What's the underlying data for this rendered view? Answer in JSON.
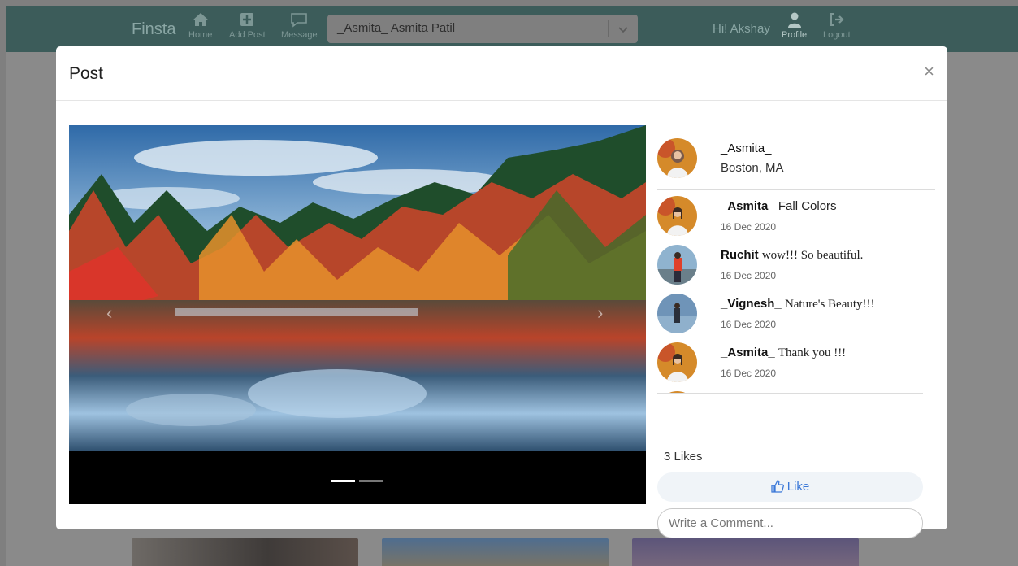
{
  "navbar": {
    "brand": "Finsta",
    "items": [
      {
        "label": "Home",
        "icon": "home-icon"
      },
      {
        "label": "Add Post",
        "icon": "add-post-icon"
      },
      {
        "label": "Message",
        "icon": "message-icon"
      },
      {
        "label": "Profile",
        "icon": "user-icon"
      },
      {
        "label": "Logout",
        "icon": "logout-icon"
      }
    ],
    "search_value": "_Asmita_ Asmita Patil",
    "greeting": "Hi! Akshay"
  },
  "modal": {
    "title": "Post",
    "close_label": "×"
  },
  "post": {
    "author": {
      "username": "_Asmita_",
      "location": "Boston, MA"
    },
    "comments": [
      {
        "username": "_Asmita_",
        "text": "Fall Colors",
        "date": "16 Dec 2020"
      },
      {
        "username": "Ruchit",
        "text": "wow!!! So beautiful.",
        "date": "16 Dec 2020"
      },
      {
        "username": "_Vignesh_",
        "text": "Nature's Beauty!!!",
        "date": "16 Dec 2020"
      },
      {
        "username": "_Asmita_",
        "text": "Thank you !!!",
        "date": "16 Dec 2020"
      }
    ],
    "likes_text": "3 Likes",
    "like_label": "Like",
    "comment_placeholder": "Write a Comment...",
    "carousel": {
      "slides": 2,
      "active": 0
    }
  },
  "colors": {
    "navbar": "#3c5c5a",
    "accent": "#3b78d8",
    "overlay": "#7f7f7f"
  }
}
